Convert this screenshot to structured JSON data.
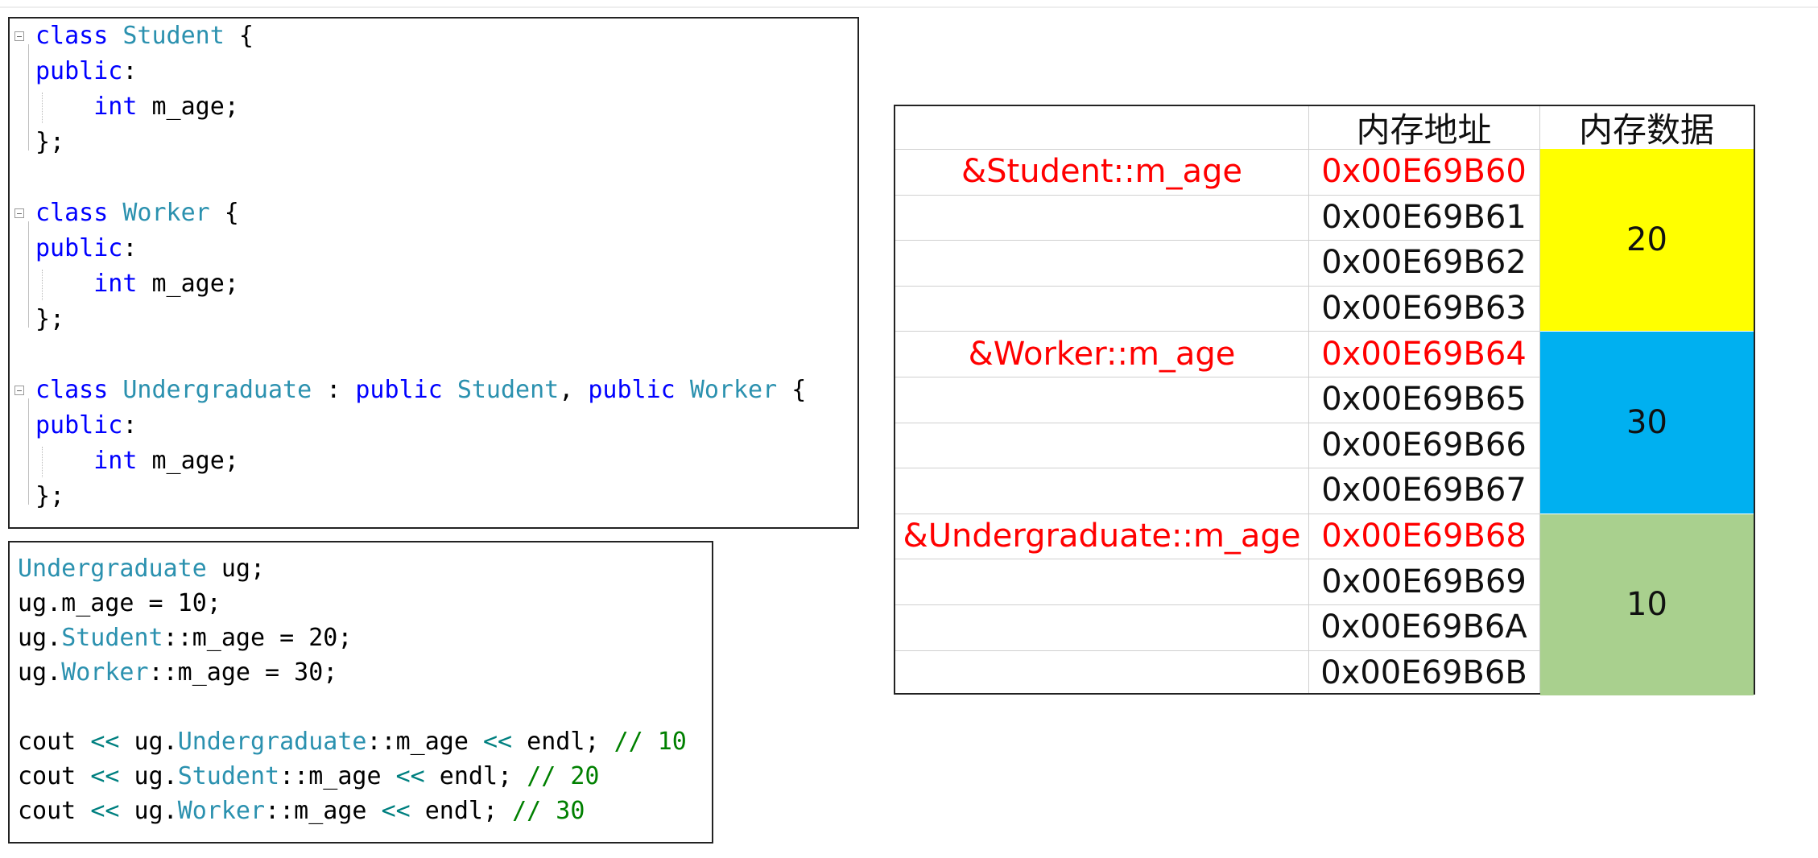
{
  "code_top": {
    "lines": [
      [
        {
          "t": "class",
          "c": "kw"
        },
        {
          "t": " "
        },
        {
          "t": "Student",
          "c": "ty"
        },
        {
          "t": " {"
        }
      ],
      [
        {
          "t": "public",
          "c": "kw"
        },
        {
          "t": ":"
        }
      ],
      [
        {
          "t": "    "
        },
        {
          "t": "int",
          "c": "kw"
        },
        {
          "t": " m_age;"
        }
      ],
      [
        {
          "t": "};"
        }
      ],
      [],
      [
        {
          "t": "class",
          "c": "kw"
        },
        {
          "t": " "
        },
        {
          "t": "Worker",
          "c": "ty"
        },
        {
          "t": " {"
        }
      ],
      [
        {
          "t": "public",
          "c": "kw"
        },
        {
          "t": ":"
        }
      ],
      [
        {
          "t": "    "
        },
        {
          "t": "int",
          "c": "kw"
        },
        {
          "t": " m_age;"
        }
      ],
      [
        {
          "t": "};"
        }
      ],
      [],
      [
        {
          "t": "class",
          "c": "kw"
        },
        {
          "t": " "
        },
        {
          "t": "Undergraduate",
          "c": "ty"
        },
        {
          "t": " : "
        },
        {
          "t": "public",
          "c": "kw"
        },
        {
          "t": " "
        },
        {
          "t": "Student",
          "c": "ty"
        },
        {
          "t": ", "
        },
        {
          "t": "public",
          "c": "kw"
        },
        {
          "t": " "
        },
        {
          "t": "Worker",
          "c": "ty"
        },
        {
          "t": " {"
        }
      ],
      [
        {
          "t": "public",
          "c": "kw"
        },
        {
          "t": ":"
        }
      ],
      [
        {
          "t": "    "
        },
        {
          "t": "int",
          "c": "kw"
        },
        {
          "t": " m_age;"
        }
      ],
      [
        {
          "t": "};"
        }
      ]
    ]
  },
  "code_bottom": {
    "lines": [
      [
        {
          "t": "Undergraduate",
          "c": "ty"
        },
        {
          "t": " ug;"
        }
      ],
      [
        {
          "t": "ug.m_age = 10;"
        }
      ],
      [
        {
          "t": "ug."
        },
        {
          "t": "Student",
          "c": "ty"
        },
        {
          "t": "::m_age = 20;"
        }
      ],
      [
        {
          "t": "ug."
        },
        {
          "t": "Worker",
          "c": "ty"
        },
        {
          "t": "::m_age = 30;"
        }
      ],
      [],
      [
        {
          "t": "cout "
        },
        {
          "t": "<<",
          "c": "op"
        },
        {
          "t": " ug."
        },
        {
          "t": "Undergraduate",
          "c": "ty"
        },
        {
          "t": "::m_age "
        },
        {
          "t": "<<",
          "c": "op"
        },
        {
          "t": " endl; "
        },
        {
          "t": "// 10",
          "c": "cm"
        }
      ],
      [
        {
          "t": "cout "
        },
        {
          "t": "<<",
          "c": "op"
        },
        {
          "t": " ug."
        },
        {
          "t": "Student",
          "c": "ty"
        },
        {
          "t": "::m_age "
        },
        {
          "t": "<<",
          "c": "op"
        },
        {
          "t": " endl; "
        },
        {
          "t": "// 20",
          "c": "cm"
        }
      ],
      [
        {
          "t": "cout "
        },
        {
          "t": "<<",
          "c": "op"
        },
        {
          "t": " ug."
        },
        {
          "t": "Worker",
          "c": "ty"
        },
        {
          "t": "::m_age "
        },
        {
          "t": "<<",
          "c": "op"
        },
        {
          "t": " endl; "
        },
        {
          "t": "// 30",
          "c": "cm"
        }
      ]
    ]
  },
  "memory_table": {
    "header_address": "内存地址",
    "header_data": "内存数据",
    "rows": [
      {
        "label": "&Student::m_age",
        "address": "0x00E69B60",
        "highlight": true
      },
      {
        "label": "",
        "address": "0x00E69B61",
        "highlight": false
      },
      {
        "label": "",
        "address": "0x00E69B62",
        "highlight": false
      },
      {
        "label": "",
        "address": "0x00E69B63",
        "highlight": false
      },
      {
        "label": "&Worker::m_age",
        "address": "0x00E69B64",
        "highlight": true
      },
      {
        "label": "",
        "address": "0x00E69B65",
        "highlight": false
      },
      {
        "label": "",
        "address": "0x00E69B66",
        "highlight": false
      },
      {
        "label": "",
        "address": "0x00E69B67",
        "highlight": false
      },
      {
        "label": "&Undergraduate::m_age",
        "address": "0x00E69B68",
        "highlight": true
      },
      {
        "label": "",
        "address": "0x00E69B69",
        "highlight": false
      },
      {
        "label": "",
        "address": "0x00E69B6A",
        "highlight": false
      },
      {
        "label": "",
        "address": "0x00E69B6B",
        "highlight": false
      }
    ],
    "blocks": [
      {
        "value": "20",
        "color": "#ffff00"
      },
      {
        "value": "30",
        "color": "#00b0f0"
      },
      {
        "value": "10",
        "color": "#a9d08e"
      }
    ],
    "highlight_color": "#ff0000"
  }
}
